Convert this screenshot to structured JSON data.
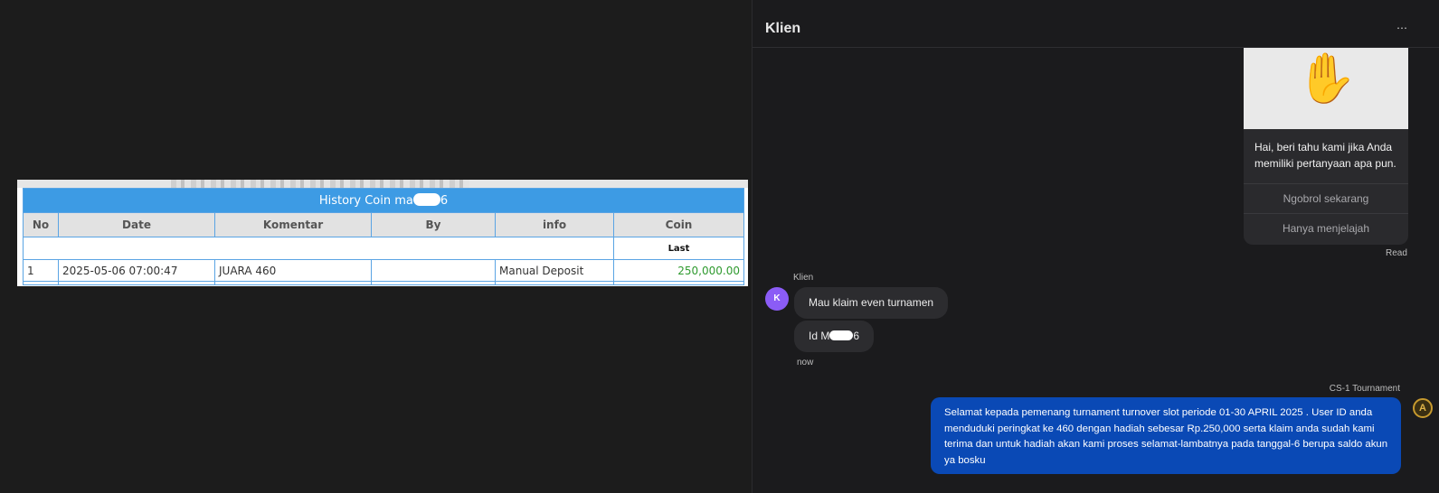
{
  "history_table": {
    "title_visible": "History Coin ma",
    "title_suffix": "6",
    "columns": [
      "No",
      "Date",
      "Komentar",
      "By",
      "info",
      "Coin"
    ],
    "last_label": "Last",
    "rows": [
      {
        "no": "1",
        "date": "2025-05-06 07:00:47",
        "komentar": "JUARA 460",
        "by": "",
        "info": "Manual Deposit",
        "coin": "250,000.00"
      }
    ]
  },
  "chat": {
    "header_title": "Klien",
    "header_dots": "⋯",
    "welcome": {
      "image_icon": "raised-hand-icon",
      "text": "Hai, beri tahu kami jika Anda memiliki pertanyaan apa pun.",
      "buttons": [
        "Ngobrol sekarang",
        "Hanya menjelajah"
      ]
    },
    "read_status": "Read",
    "customer": {
      "name": "Klien",
      "avatar_initial": "K",
      "messages": [
        "Mau klaim even turnamen"
      ],
      "id_prefix": "Id M",
      "id_suffix": "6",
      "time": "now"
    },
    "agent": {
      "name": "CS-1 Tournament",
      "avatar_initial": "A",
      "message": "Selamat kepada pemenang turnament turnover slot periode 01-30 APRIL 2025 . User ID anda menduduki peringkat ke 460 dengan hadiah sebesar Rp.250,000 serta klaim anda sudah kami terima dan untuk hadiah akan kami proses selamat-lambatnya pada tanggal-6 berupa saldo akun ya bosku"
    }
  },
  "colors": {
    "page_bg": "#1c1c1c",
    "table_header_blue": "#3d9be4",
    "coin_green": "#2f9a2f",
    "agent_bubble": "#0a49b5",
    "customer_avatar": "#8b5cf6"
  }
}
